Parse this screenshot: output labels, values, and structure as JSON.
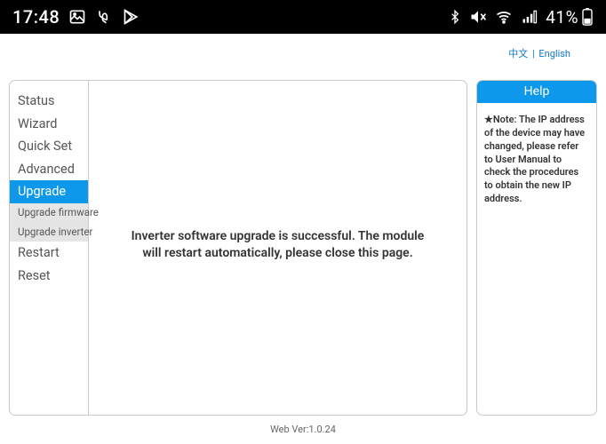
{
  "statusbar": {
    "time": "17:48",
    "battery_text": "41%"
  },
  "lang": {
    "cn": "中文",
    "sep": "|",
    "en": "English"
  },
  "sidebar": {
    "items": [
      {
        "label": "Status",
        "active": false
      },
      {
        "label": "Wizard",
        "active": false
      },
      {
        "label": "Quick Set",
        "active": false
      },
      {
        "label": "Advanced",
        "active": false
      },
      {
        "label": "Upgrade",
        "active": true
      }
    ],
    "subitems": [
      {
        "label": "Upgrade firmware"
      },
      {
        "label": "Upgrade inverter"
      }
    ],
    "tail": [
      {
        "label": "Restart"
      },
      {
        "label": "Reset"
      }
    ]
  },
  "content": {
    "message": "Inverter software upgrade is successful. The module will restart automatically, please close this page."
  },
  "help": {
    "title": "Help",
    "note": "★Note: The IP address of the device may have changed, please refer to User Manual to check the procedures to obtain the new IP address."
  },
  "footer": {
    "version": "Web Ver:1.0.24"
  }
}
